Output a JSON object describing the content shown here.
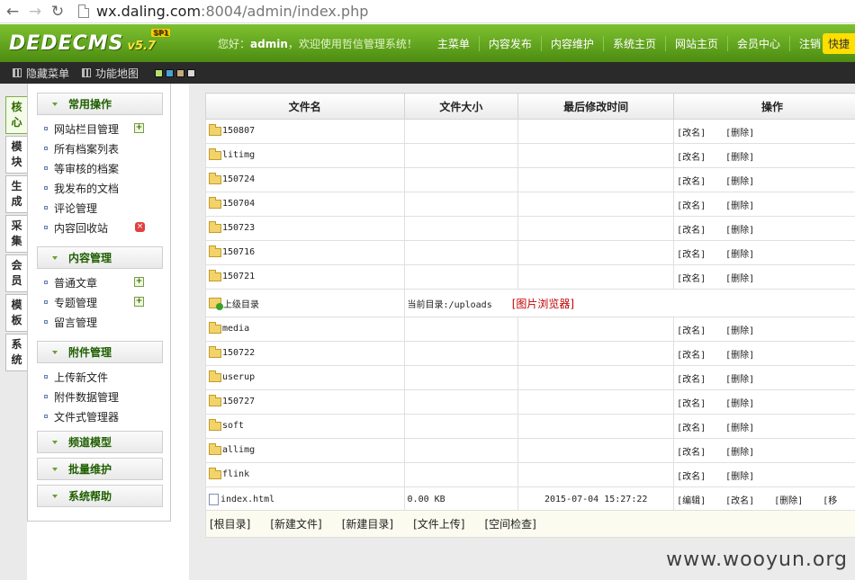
{
  "browser": {
    "url_host": "wx.daling.com",
    "url_rest": ":8004/admin/index.php"
  },
  "header": {
    "logo": "DEDECMS",
    "version": "v5.7",
    "sp": "SP1",
    "greet_prefix": "您好：",
    "user": "admin",
    "greet_suffix": "，欢迎使用哲信管理系统！",
    "menu": [
      "主菜单",
      "内容发布",
      "内容维护",
      "系统主页",
      "网站主页",
      "会员中心",
      "注销"
    ],
    "quick": "快捷"
  },
  "subbar": {
    "hide_menu": "隐藏菜单",
    "site_map": "功能地图",
    "skin_colors": [
      "#b7e06b",
      "#4aa0d8",
      "#c7a97a",
      "#d8d8d8"
    ]
  },
  "vtabs": [
    "核心",
    "模块",
    "生成",
    "采集",
    "会员",
    "模板",
    "系统"
  ],
  "sidebar": {
    "sections": [
      {
        "title": "常用操作",
        "items": [
          "网站栏目管理",
          "所有档案列表",
          "等审核的档案",
          "我发布的文档",
          "评论管理",
          "内容回收站"
        ]
      },
      {
        "title": "内容管理",
        "items": [
          "普通文章",
          "专题管理",
          "留言管理"
        ]
      },
      {
        "title": "附件管理",
        "items": [
          "上传新文件",
          "附件数据管理",
          "文件式管理器"
        ]
      },
      {
        "title": "频道模型",
        "items": []
      },
      {
        "title": "批量维护",
        "items": []
      },
      {
        "title": "系统帮助",
        "items": []
      }
    ]
  },
  "table": {
    "headers": [
      "文件名",
      "文件大小",
      "最后修改时间",
      "操作"
    ],
    "rename": "[改名]",
    "delete": "[删除]",
    "edit": "[编辑]",
    "move": "[移",
    "parent": {
      "label": "上级目录",
      "current": "当前目录:/uploads",
      "browser": "[图片浏览器]"
    },
    "folders_top": [
      "150807",
      "litimg",
      "150724",
      "150704",
      "150723",
      "150716",
      "150721"
    ],
    "folders_bottom": [
      "media",
      "150722",
      "userup",
      "150727",
      "soft",
      "allimg",
      "flink"
    ],
    "file": {
      "name": "index.html",
      "size": "0.00 KB",
      "mtime": "2015-07-04 15:27:22"
    }
  },
  "actions": [
    "[根目录]",
    "[新建文件]",
    "[新建目录]",
    "[文件上传]",
    "[空间检查]"
  ],
  "watermark": "www.wooyun.org"
}
